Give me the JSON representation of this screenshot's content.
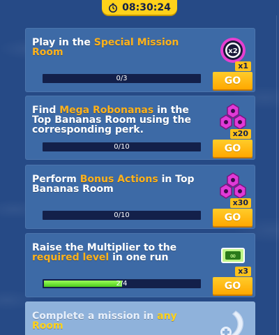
{
  "timer": {
    "value": "08:30:24",
    "icon": "stopwatch-icon"
  },
  "missions": [
    {
      "title_parts": [
        "Play in the ",
        "Special Mission Room",
        ""
      ],
      "progress_text": "0/3",
      "progress": 0,
      "reward_icon": "special-mission-coin-icon",
      "multiplier": "x1",
      "go_label": "GO"
    },
    {
      "title_parts": [
        "Find ",
        "Mega Robonanas",
        " in the Top Bananas Room using the corresponding perk."
      ],
      "progress_text": "0/10",
      "progress": 0,
      "reward_icon": "magenta-gems-icon",
      "multiplier": "x20",
      "go_label": "GO"
    },
    {
      "title_parts": [
        "Perform ",
        "Bonus Actions",
        " in Top Bananas Room"
      ],
      "progress_text": "0/10",
      "progress": 0,
      "reward_icon": "magenta-gems-icon",
      "multiplier": "x30",
      "go_label": "GO"
    },
    {
      "title_parts": [
        "Raise the Multiplier to the ",
        "required level",
        " in one run"
      ],
      "progress_text": "2/4",
      "progress": 0.5,
      "reward_icon": "multiplier-ticket-icon",
      "multiplier": "x3",
      "go_label": "GO"
    },
    {
      "title_parts": [
        "Complete a mission in ",
        "any Room",
        ""
      ],
      "reward_icon": "banana-plus-icon"
    }
  ],
  "colors": {
    "accent": "#ffb21a",
    "go_button": "#ffb000",
    "bar_fill": "#6ee030",
    "card": "#3d6aa6"
  }
}
